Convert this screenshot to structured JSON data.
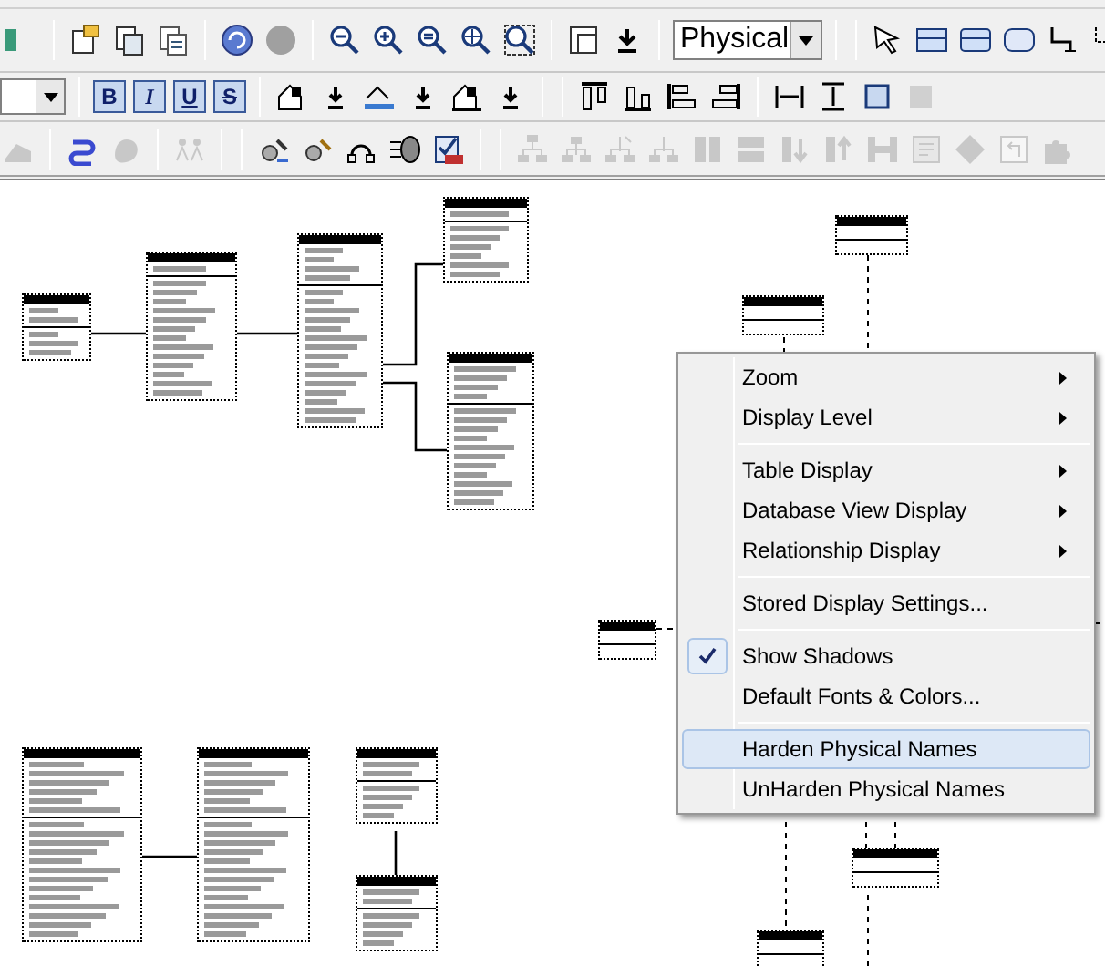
{
  "toolbar": {
    "model_view": {
      "value": "Physical"
    },
    "format_buttons": [
      {
        "label": "B"
      },
      {
        "label": "I"
      },
      {
        "label": "U"
      },
      {
        "label": "S"
      }
    ]
  },
  "context_menu": {
    "sections": [
      [
        {
          "label": "Zoom",
          "submenu": true,
          "checked": false,
          "selected": false
        },
        {
          "label": "Display Level",
          "submenu": true,
          "checked": false,
          "selected": false
        }
      ],
      [
        {
          "label": "Table Display",
          "submenu": true,
          "checked": false,
          "selected": false
        },
        {
          "label": "Database View Display",
          "submenu": true,
          "checked": false,
          "selected": false
        },
        {
          "label": "Relationship Display",
          "submenu": true,
          "checked": false,
          "selected": false
        }
      ],
      [
        {
          "label": "Stored Display Settings...",
          "submenu": false,
          "checked": false,
          "selected": false
        }
      ],
      [
        {
          "label": "Show Shadows",
          "submenu": false,
          "checked": true,
          "selected": false
        },
        {
          "label": "Default Fonts & Colors...",
          "submenu": false,
          "checked": false,
          "selected": false
        }
      ],
      [
        {
          "label": "Harden Physical Names",
          "submenu": false,
          "checked": false,
          "selected": true
        },
        {
          "label": "UnHarden Physical Names",
          "submenu": false,
          "checked": false,
          "selected": false
        }
      ]
    ]
  }
}
